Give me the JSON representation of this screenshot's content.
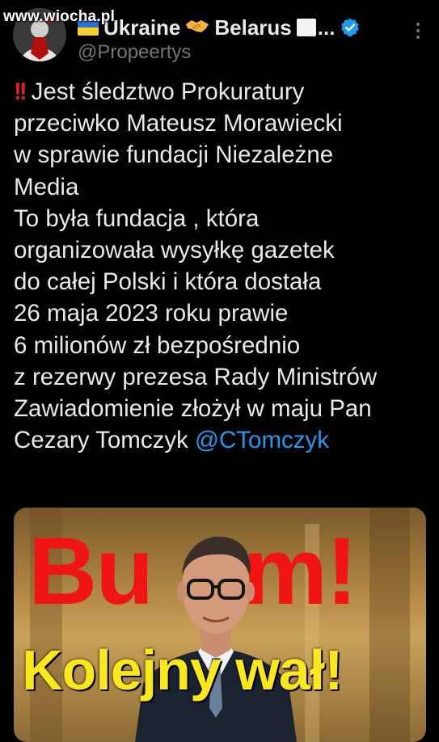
{
  "watermark": "www.wiocha.pl",
  "author": {
    "name_part1": "Ukraine",
    "name_part2": "Belarus",
    "name_ellipsis": "...",
    "handle": "@Propeertys",
    "verified": true
  },
  "tweet": {
    "prefix_emoji": "!!",
    "lines": [
      "Jest śledztwo Prokuratury",
      "przeciwko Mateusz Morawiecki",
      "w sprawie fundacji Niezależne",
      "Media",
      "To była fundacja , która",
      "organizowała wysyłkę gazetek",
      "do całej Polski i która dostała",
      "26 maja 2023 roku prawie",
      "6 milionów zł bezpośrednio",
      "z rezerwy prezesa Rady Ministrów",
      "Zawiadomienie złożył w maju Pan"
    ],
    "last_line_text": "Cezary Tomczyk",
    "mention": "@CTomczyk"
  },
  "media": {
    "headline_left": "Bu",
    "headline_right": "m!",
    "subheadline": "Kolejny wał!"
  },
  "colors": {
    "background": "#000000",
    "text": "#e7e9ea",
    "secondary_text": "#71767b",
    "link": "#1d9bf0",
    "verified_badge": "#1d9bf0",
    "headline_red": "#f01414",
    "subheadline_yellow": "#f8e81c"
  },
  "icons": {
    "verified": "verified-badge-icon",
    "more": "more-options-icon",
    "flag": "ukraine-flag-icon",
    "handshake": "handshake-icon",
    "square": "white-square-icon",
    "exclamation": "double-exclamation-icon"
  }
}
